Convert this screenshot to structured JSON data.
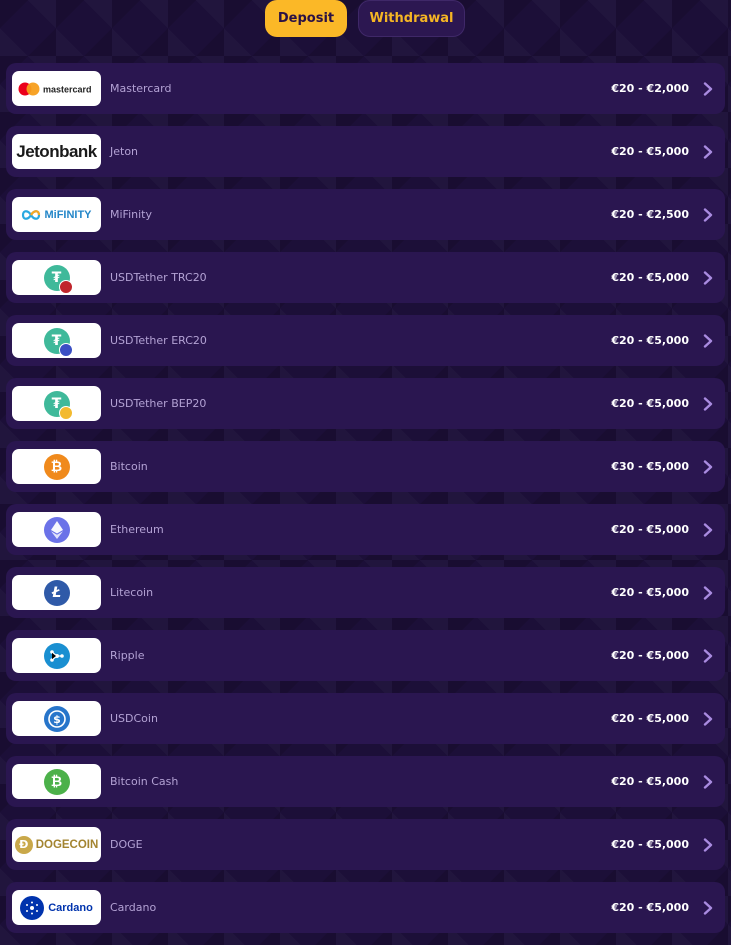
{
  "tabs": {
    "deposit": "Deposit",
    "withdrawal": "Withdrawal"
  },
  "methods": [
    {
      "name": "Mastercard",
      "range": "€20 - €2,000",
      "logo_text": "mastercard",
      "icon": "mastercard-logo-icon"
    },
    {
      "name": "Jeton",
      "range": "€20 - €5,000",
      "logo_text": "Jetonbank",
      "icon": "jetonbank-logo-icon"
    },
    {
      "name": "MiFinity",
      "range": "€20 - €2,500",
      "logo_text": "MiFINITY",
      "icon": "mifinity-logo-icon"
    },
    {
      "name": "USDTether TRC20",
      "range": "€20 - €5,000",
      "icon": "tether-trc20-icon"
    },
    {
      "name": "USDTether ERC20",
      "range": "€20 - €5,000",
      "icon": "tether-erc20-icon"
    },
    {
      "name": "USDTether BEP20",
      "range": "€20 - €5,000",
      "icon": "tether-bep20-icon"
    },
    {
      "name": "Bitcoin",
      "range": "€30 - €5,000",
      "icon": "bitcoin-icon"
    },
    {
      "name": "Ethereum",
      "range": "€20 - €5,000",
      "icon": "ethereum-icon"
    },
    {
      "name": "Litecoin",
      "range": "€20 - €5,000",
      "icon": "litecoin-icon"
    },
    {
      "name": "Ripple",
      "range": "€20 - €5,000",
      "icon": "ripple-icon"
    },
    {
      "name": "USDCoin",
      "range": "€20 - €5,000",
      "icon": "usdcoin-icon"
    },
    {
      "name": "Bitcoin Cash",
      "range": "€20 - €5,000",
      "icon": "bitcoin-cash-icon"
    },
    {
      "name": "DOGE",
      "range": "€20 - €5,000",
      "logo_text": "DOGECOIN",
      "icon": "dogecoin-icon"
    },
    {
      "name": "Cardano",
      "range": "€20 - €5,000",
      "logo_text": "Cardano",
      "icon": "cardano-icon"
    }
  ],
  "colors": {
    "background": "#1c0f38",
    "row": "#2a1650",
    "deposit_tab": "#fbb827",
    "withdrawal_text": "#f5b524",
    "chevron": "#a98be0"
  }
}
